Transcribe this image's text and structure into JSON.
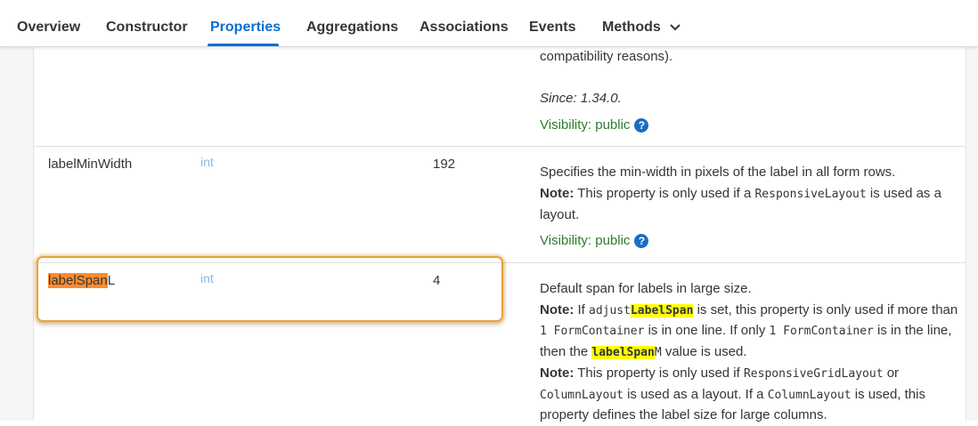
{
  "tabs": [
    {
      "label": "Overview"
    },
    {
      "label": "Constructor"
    },
    {
      "label": "Properties"
    },
    {
      "label": "Aggregations"
    },
    {
      "label": "Associations"
    },
    {
      "label": "Events"
    },
    {
      "label": "Methods"
    }
  ],
  "active_tab": "Properties",
  "prev_row": {
    "desc_tail": "compatibility reasons).",
    "since": "Since: 1.34.0.",
    "visibility": "Visibility: public"
  },
  "rows": [
    {
      "name": "labelMinWidth",
      "type": "int",
      "default": "192",
      "desc_line1": "Specifies the min-width in pixels of the label in all form rows.",
      "note_label": "Note:",
      "desc_line2_a": " This property is only used if a ",
      "desc_line2_code": "ResponsiveLayout",
      "desc_line2_b": " is used as a",
      "desc_line3": "layout.",
      "visibility": "Visibility: public"
    },
    {
      "name_hl": "labelSpan",
      "name_rest": "L",
      "type": "int",
      "default": "4",
      "desc_line1": "Default span for labels in large size.",
      "note_label": "Note:",
      "l2_a": " If ",
      "l2_code1": "adjust",
      "l2_code_hl": "LabelSpan",
      "l2_b": " is set, this property is only used if more than",
      "l3_code1": "1 FormContainer",
      "l3_a": " is in one line. If only ",
      "l3_code2": "1 FormContainer",
      "l3_b": " is in the line,",
      "l4_a": "then the ",
      "l4_code_hl": "labelSpan",
      "l4_code_rest": "M",
      "l4_b": " value is used.",
      "note2_label": "Note:",
      "l5_a": " This property is only used if ",
      "l5_code": "ResponsiveGridLayout",
      "l5_b": " or",
      "l6_code1": "ColumnLayout",
      "l6_a": " is used as a layout. If a ",
      "l6_code2": "ColumnLayout",
      "l6_b": " is used, this",
      "l7": "property defines the label size for large columns."
    }
  ]
}
